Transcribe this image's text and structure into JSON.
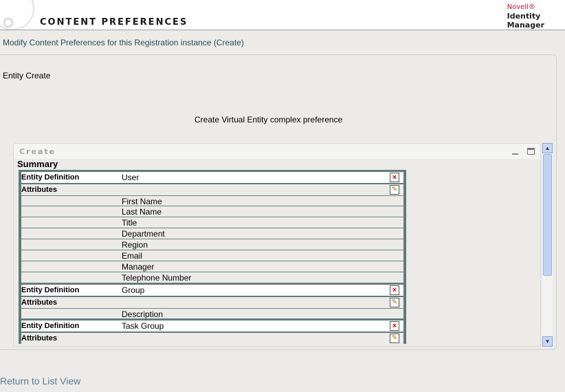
{
  "header": {
    "title": "CONTENT PREFERENCES",
    "brand_novell": "Novell®",
    "brand_line1": "Identity",
    "brand_line2": "Manager"
  },
  "subtitle": "Modify Content Preferences for this Registration instance (Create)",
  "panel": {
    "entity_create": "Entity Create",
    "center_text": "Create Virtual Entity complex preference"
  },
  "portlet": {
    "title": "Create",
    "summary_title": "Summary",
    "labels": {
      "entity_definition": "Entity Definition",
      "attributes": "Attributes"
    },
    "entities": [
      {
        "definition": "User",
        "attributes": [
          "First Name",
          "Last Name",
          "Title",
          "Department",
          "Region",
          "Email",
          "Manager",
          "Telephone Number"
        ]
      },
      {
        "definition": "Group",
        "attributes": [
          "Description"
        ]
      },
      {
        "definition": "Task Group",
        "attributes": []
      }
    ]
  },
  "icons": {
    "delete": "×",
    "edit": "✎",
    "scroll_up": "▲",
    "scroll_down": "▼"
  },
  "colors": {
    "summary_border": "#5f7b7c",
    "delete": "#d10000",
    "link": "#5a7e96"
  },
  "footer": {
    "return_link": "Return to List View"
  }
}
